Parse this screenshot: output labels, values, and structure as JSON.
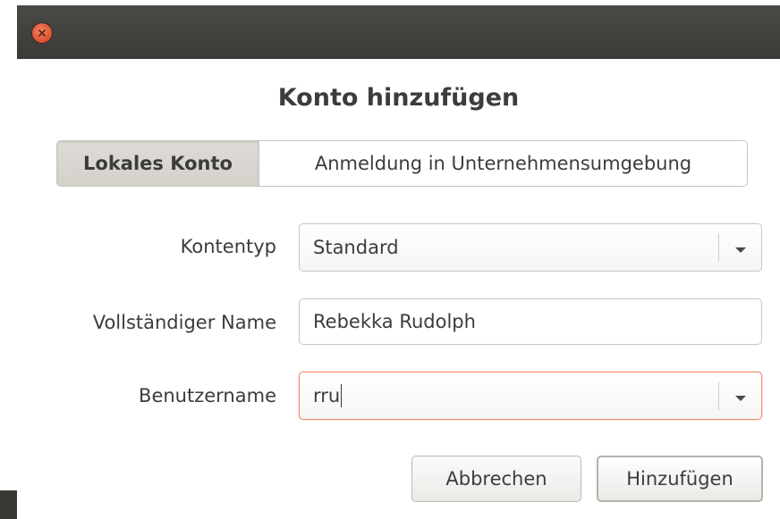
{
  "window": {
    "close_icon": "close-icon",
    "accent": "#de4f2d"
  },
  "dialog": {
    "title": "Konto hinzufügen",
    "tabs": [
      {
        "label": "Lokales Konto",
        "selected": true
      },
      {
        "label": "Anmeldung in Unternehmensumgebung",
        "selected": false
      }
    ],
    "account_type": {
      "label": "Kontentyp",
      "value": "Standard",
      "icon": "chevron-down-icon"
    },
    "full_name": {
      "label": "Vollständiger Name",
      "value": "Rebekka Rudolph"
    },
    "username": {
      "label": "Benutzername",
      "value": "rru",
      "icon": "chevron-down-icon",
      "focus_color": "#f0906e"
    },
    "buttons": {
      "cancel": "Abbrechen",
      "add": "Hinzufügen"
    }
  }
}
